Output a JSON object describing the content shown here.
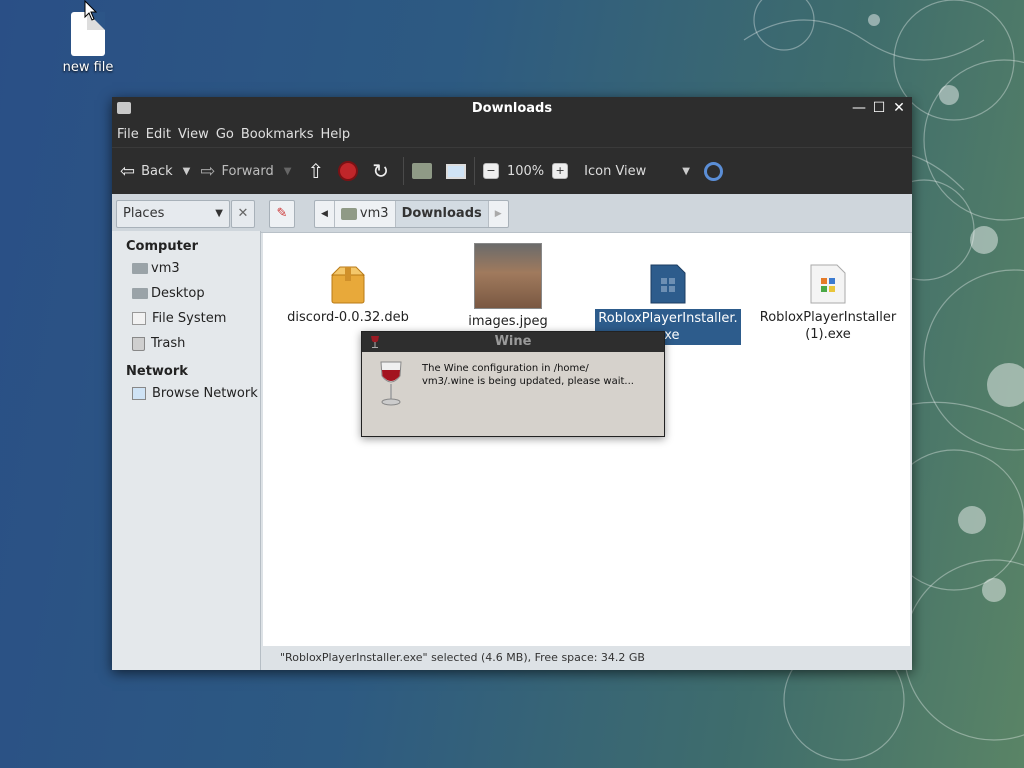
{
  "desktop": {
    "icon_label": "new file"
  },
  "window": {
    "title": "Downloads",
    "controls": {
      "minimize": "—",
      "maximize": "☐",
      "close": "✕"
    }
  },
  "menubar": [
    "File",
    "Edit",
    "View",
    "Go",
    "Bookmarks",
    "Help"
  ],
  "toolbar": {
    "back_label": "Back",
    "forward_label": "Forward",
    "zoom_level": "100%",
    "zoom_out": "−",
    "zoom_in": "+",
    "view_mode": "Icon View"
  },
  "location": {
    "places_label": "Places",
    "breadcrumbs": [
      "vm3",
      "Downloads"
    ]
  },
  "sidebar": {
    "sections": [
      {
        "heading": "Computer",
        "items": [
          "vm3",
          "Desktop",
          "File System",
          "Trash"
        ]
      },
      {
        "heading": "Network",
        "items": [
          "Browse Network"
        ]
      }
    ]
  },
  "files": [
    {
      "name": "discord-0.0.32.deb",
      "icon": "package-icon",
      "selected": false
    },
    {
      "name": "images.jpeg",
      "icon": "photo-thumbnail",
      "selected": false
    },
    {
      "name_line1": "RobloxPlayerInstaller.",
      "name_line2": "exe",
      "icon": "exe-icon",
      "selected": true
    },
    {
      "name_line1": "RobloxPlayerInstaller",
      "name_line2": "(1).exe",
      "icon": "exe-icon",
      "selected": false
    }
  ],
  "statusbar": {
    "text": "\"RobloxPlayerInstaller.exe\" selected (4.6 MB), Free space: 34.2 GB"
  },
  "wine_dialog": {
    "title": "Wine",
    "message_line1": "The Wine configuration in /home/",
    "message_line2": "vm3/.wine is being updated, please wait..."
  },
  "colors": {
    "selection": "#2d5c8c",
    "titlebar": "#2d2d2d",
    "stop_red": "#c0262a"
  }
}
